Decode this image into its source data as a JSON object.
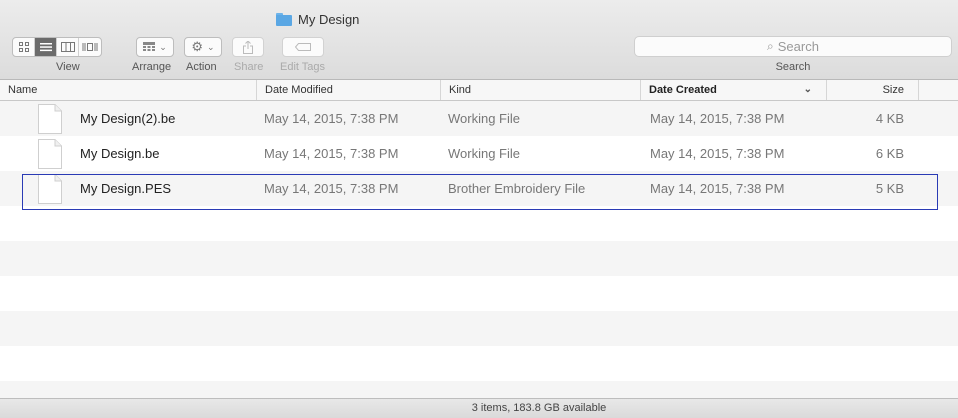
{
  "window": {
    "title": "My Design",
    "title_icon": "folder-icon"
  },
  "toolbar": {
    "view_label": "View",
    "arrange_label": "Arrange",
    "action_label": "Action",
    "share_label": "Share",
    "edit_tags_label": "Edit Tags",
    "search_placeholder": "Search",
    "search_label": "Search"
  },
  "columns": {
    "name": "Name",
    "date_modified": "Date Modified",
    "kind": "Kind",
    "date_created": "Date Created",
    "size": "Size"
  },
  "files": [
    {
      "name": "My Design(2).be",
      "date_modified": "May 14, 2015, 7:38 PM",
      "kind": "Working File",
      "date_created": "May 14, 2015, 7:38 PM",
      "size": "4 KB"
    },
    {
      "name": "My Design.be",
      "date_modified": "May 14, 2015, 7:38 PM",
      "kind": "Working File",
      "date_created": "May 14, 2015, 7:38 PM",
      "size": "6 KB"
    },
    {
      "name": "My Design.PES",
      "date_modified": "May 14, 2015, 7:38 PM",
      "kind": "Brother Embroidery File",
      "date_created": "May 14, 2015, 7:38 PM",
      "size": "5 KB"
    }
  ],
  "status": {
    "text": "3 items, 183.8 GB available"
  },
  "colors": {
    "folder": "#5aa7e4",
    "selection_outline": "#2a3bb5",
    "active_view": "#6b6b6b"
  }
}
